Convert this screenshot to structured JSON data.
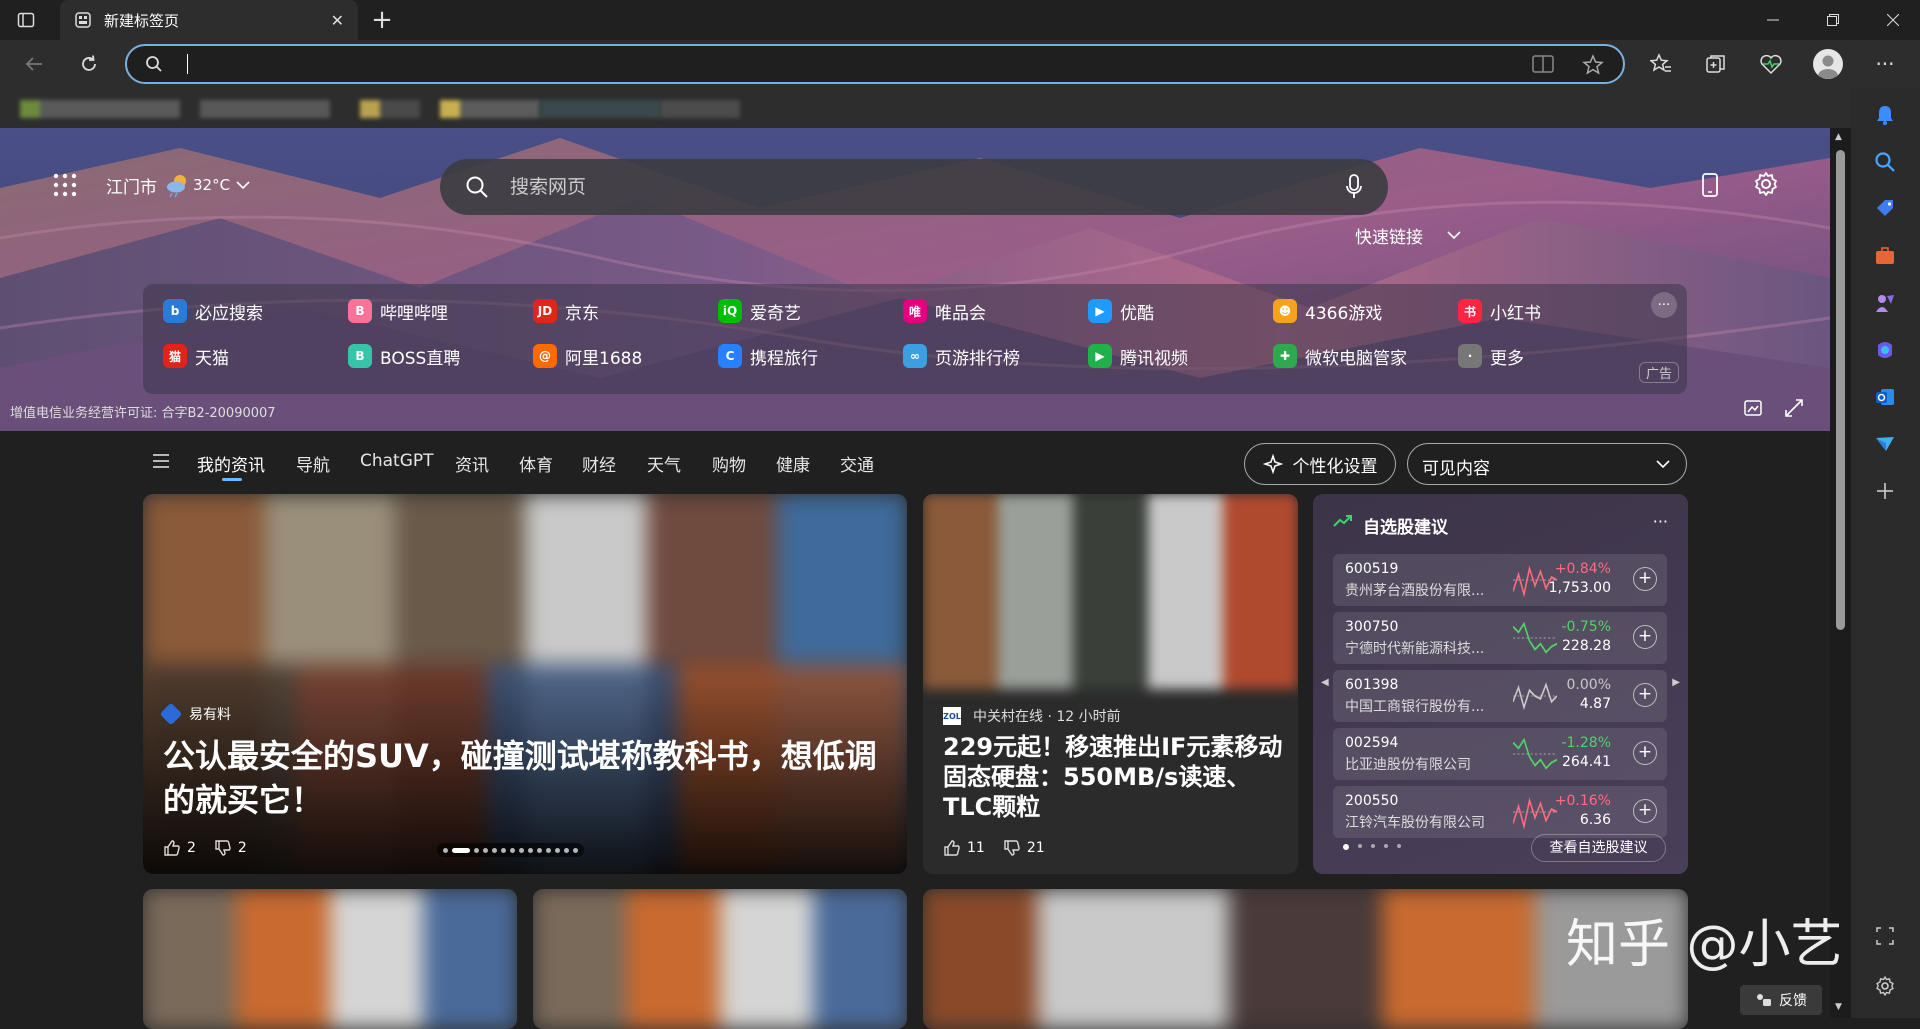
{
  "browser": {
    "tab_title": "新建标签页",
    "new_tab_label": "+",
    "address_value": ""
  },
  "header": {
    "city": "江门市",
    "temperature": "32°C",
    "search_placeholder": "搜索网页",
    "quick_links_label": "快速链接",
    "license_text": "增值电信业务经营许可证: 合字B2-20090007",
    "ad_label": "广告"
  },
  "quick_links": [
    {
      "label": "必应搜索",
      "icon": "bing-icon",
      "color": "#2a7bd6",
      "glyph": "b"
    },
    {
      "label": "哔哩哔哩",
      "icon": "bilibili-icon",
      "color": "#fb7299",
      "glyph": "B"
    },
    {
      "label": "京东",
      "icon": "jd-icon",
      "color": "#e1251b",
      "glyph": "JD"
    },
    {
      "label": "爱奇艺",
      "icon": "iqiyi-icon",
      "color": "#00be06",
      "glyph": "iQ"
    },
    {
      "label": "唯品会",
      "icon": "vip-icon",
      "color": "#e6007e",
      "glyph": "唯"
    },
    {
      "label": "优酷",
      "icon": "youku-icon",
      "color": "#1e9bff",
      "glyph": "▶"
    },
    {
      "label": "4366游戏",
      "icon": "4366-icon",
      "color": "#f6a21d",
      "glyph": "☻"
    },
    {
      "label": "小红书",
      "icon": "xiaohongshu-icon",
      "color": "#ff2442",
      "glyph": "书"
    },
    {
      "label": "天猫",
      "icon": "tmall-icon",
      "color": "#e2231a",
      "glyph": "猫"
    },
    {
      "label": "BOSS直聘",
      "icon": "boss-icon",
      "color": "#36c5a8",
      "glyph": "B"
    },
    {
      "label": "阿里1688",
      "icon": "1688-icon",
      "color": "#ff6a00",
      "glyph": "@"
    },
    {
      "label": "携程旅行",
      "icon": "ctrip-icon",
      "color": "#2681ff",
      "glyph": "C"
    },
    {
      "label": "页游排行榜",
      "icon": "game-rank-icon",
      "color": "#3aa0e0",
      "glyph": "∞"
    },
    {
      "label": "腾讯视频",
      "icon": "tencent-video-icon",
      "color": "#21b14b",
      "glyph": "▶"
    },
    {
      "label": "微软电脑管家",
      "icon": "pc-manager-icon",
      "color": "#2fa84f",
      "glyph": "✚"
    },
    {
      "label": "更多",
      "icon": "more-icon",
      "color": "#777777",
      "glyph": "·"
    }
  ],
  "feed_nav": {
    "tabs": [
      "我的资讯",
      "导航",
      "ChatGPT",
      "资讯",
      "体育",
      "财经",
      "天气",
      "购物",
      "健康",
      "交通"
    ],
    "personalize_label": "个性化设置",
    "visible_content_label": "可见内容"
  },
  "main_article": {
    "source": "易有料",
    "headline": "公认最安全的SUV，碰撞测试堪称教科书，想低调的就买它！",
    "likes": "2",
    "dislikes": "2",
    "carousel_total": 14,
    "carousel_active": 2
  },
  "second_article": {
    "source": "中关村在线 · 12 小时前",
    "headline": "229元起！移速推出IF元素移动固态硬盘：550MB/s读速、TLC颗粒",
    "likes": "11",
    "dislikes": "21"
  },
  "stocks": {
    "title": "自选股建议",
    "more_label": "···",
    "view_label": "查看自选股建议",
    "items": [
      {
        "code": "600519",
        "name": "贵州茅台酒股份有限...",
        "change": "+0.84%",
        "price": "1,753.00",
        "trend": "up"
      },
      {
        "code": "300750",
        "name": "宁德时代新能源科技...",
        "change": "-0.75%",
        "price": "228.28",
        "trend": "down"
      },
      {
        "code": "601398",
        "name": "中国工商银行股份有...",
        "change": "0.00%",
        "price": "4.87",
        "trend": "flat"
      },
      {
        "code": "002594",
        "name": "比亚迪股份有限公司",
        "change": "-1.28%",
        "price": "264.41",
        "trend": "down"
      },
      {
        "code": "200550",
        "name": "江铃汽车股份有限公司",
        "change": "+0.16%",
        "price": "6.36",
        "trend": "up"
      }
    ],
    "colors": {
      "up": "#ff6b7f",
      "down": "#4fd36a",
      "flat": "#c8c8c8"
    }
  },
  "watermark": "知乎 @小艺",
  "feedback_label": "反馈"
}
